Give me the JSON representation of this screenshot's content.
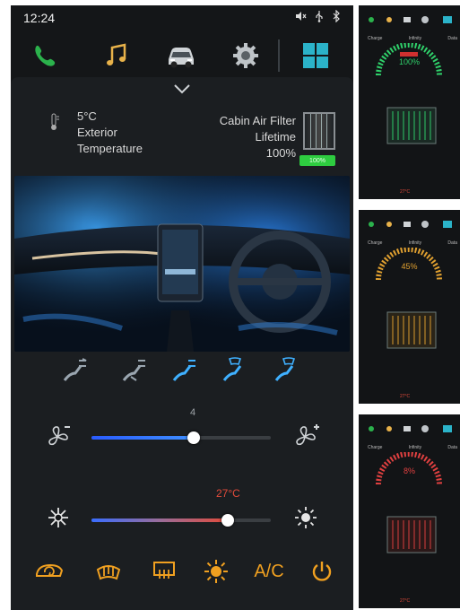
{
  "status": {
    "time": "12:24"
  },
  "exterior": {
    "temp": "5°C",
    "line1": "Exterior",
    "line2": "Temperature"
  },
  "filter": {
    "line1": "Cabin Air Filter",
    "line2": "Lifetime",
    "percent": "100%",
    "bar_percent": "100%",
    "level": 1.0
  },
  "fan": {
    "level": "4",
    "fill": 0.57
  },
  "temperature": {
    "value": "27°C",
    "fill": 0.76
  },
  "bottom": {
    "ac_label": "A/C"
  },
  "thumbnails": [
    {
      "percent": "100%",
      "color": "#2fd06a",
      "tab1": "Charge",
      "tab2": "Infinity",
      "tab3": "Data",
      "temp": "27°C"
    },
    {
      "percent": "45%",
      "color": "#e0a030",
      "tab1": "Charge",
      "tab2": "Infinity",
      "tab3": "Data",
      "temp": "27°C"
    },
    {
      "percent": "8%",
      "color": "#e04040",
      "tab1": "Charge",
      "tab2": "Infinity",
      "tab3": "Data",
      "temp": "27°C"
    }
  ],
  "colors": {
    "accent_blue": "#3fb0ff",
    "accent_orange": "#f0a020",
    "temp_red": "#e24b3b",
    "filter_green": "#2ecc40"
  },
  "icons": {
    "nav": [
      "phone-icon",
      "music-icon",
      "car-icon",
      "settings-gear-icon",
      "apps-grid-icon"
    ],
    "status": [
      "mute-icon",
      "usb-icon",
      "bluetooth-icon"
    ],
    "vents": [
      "vent-face-icon",
      "vent-face-feet-icon",
      "vent-feet-icon",
      "vent-feet-defrost-icon",
      "vent-defrost-icon"
    ],
    "bottom": [
      "recirculation-icon",
      "front-defrost-icon",
      "rear-defrost-icon",
      "brightness-icon",
      "power-icon"
    ]
  }
}
